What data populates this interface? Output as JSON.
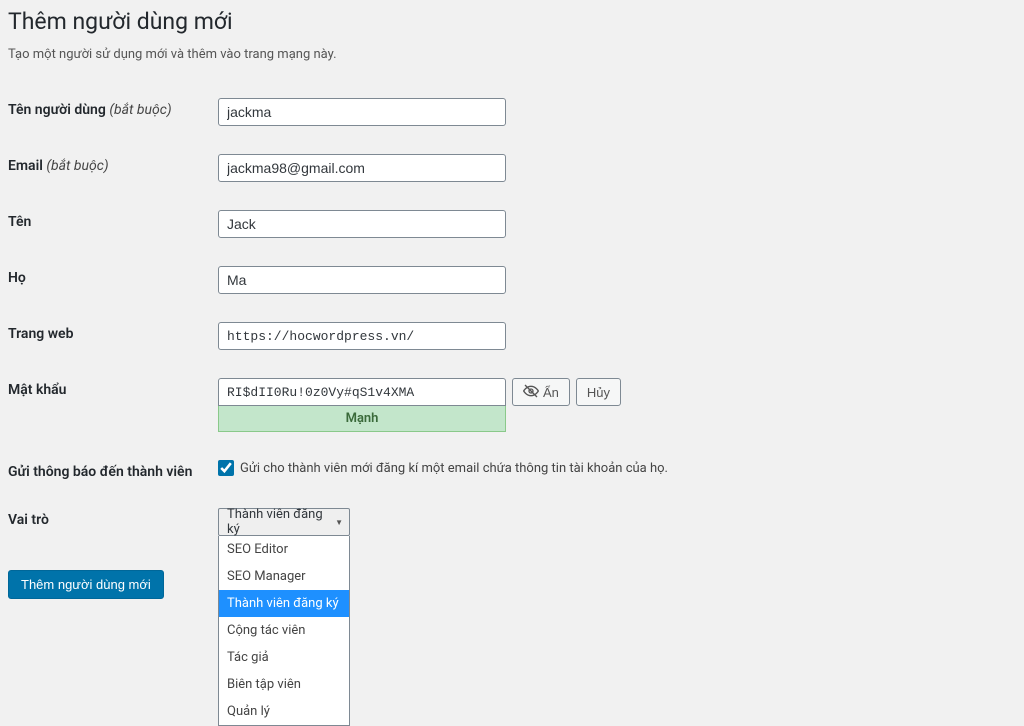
{
  "page": {
    "title": "Thêm người dùng mới",
    "subtitle": "Tạo một người sử dụng mới và thêm vào trang mạng này."
  },
  "labels": {
    "username": "Tên người dùng",
    "email": "Email",
    "firstname": "Tên",
    "lastname": "Họ",
    "website": "Trang web",
    "password": "Mật khẩu",
    "notify": "Gửi thông báo đến thành viên",
    "role": "Vai trò",
    "required": "(bắt buộc)"
  },
  "values": {
    "username": "jackma",
    "email": "jackma98@gmail.com",
    "firstname": "Jack",
    "lastname": "Ma",
    "website": "https://hocwordpress.vn/",
    "password": "RI$dII0Ru!0z0Vy#qS1v4XMA",
    "password_strength": "Mạnh",
    "notify_text": "Gửi cho thành viên mới đăng kí một email chứa thông tin tài khoản của họ.",
    "role_selected": "Thành viên đăng ký"
  },
  "buttons": {
    "hide": "Ẩn",
    "cancel": "Hủy",
    "submit": "Thêm người dùng mới"
  },
  "role_options": [
    "SEO Editor",
    "SEO Manager",
    "Thành viên đăng ký",
    "Cộng tác viên",
    "Tác giả",
    "Biên tập viên",
    "Quản lý"
  ]
}
